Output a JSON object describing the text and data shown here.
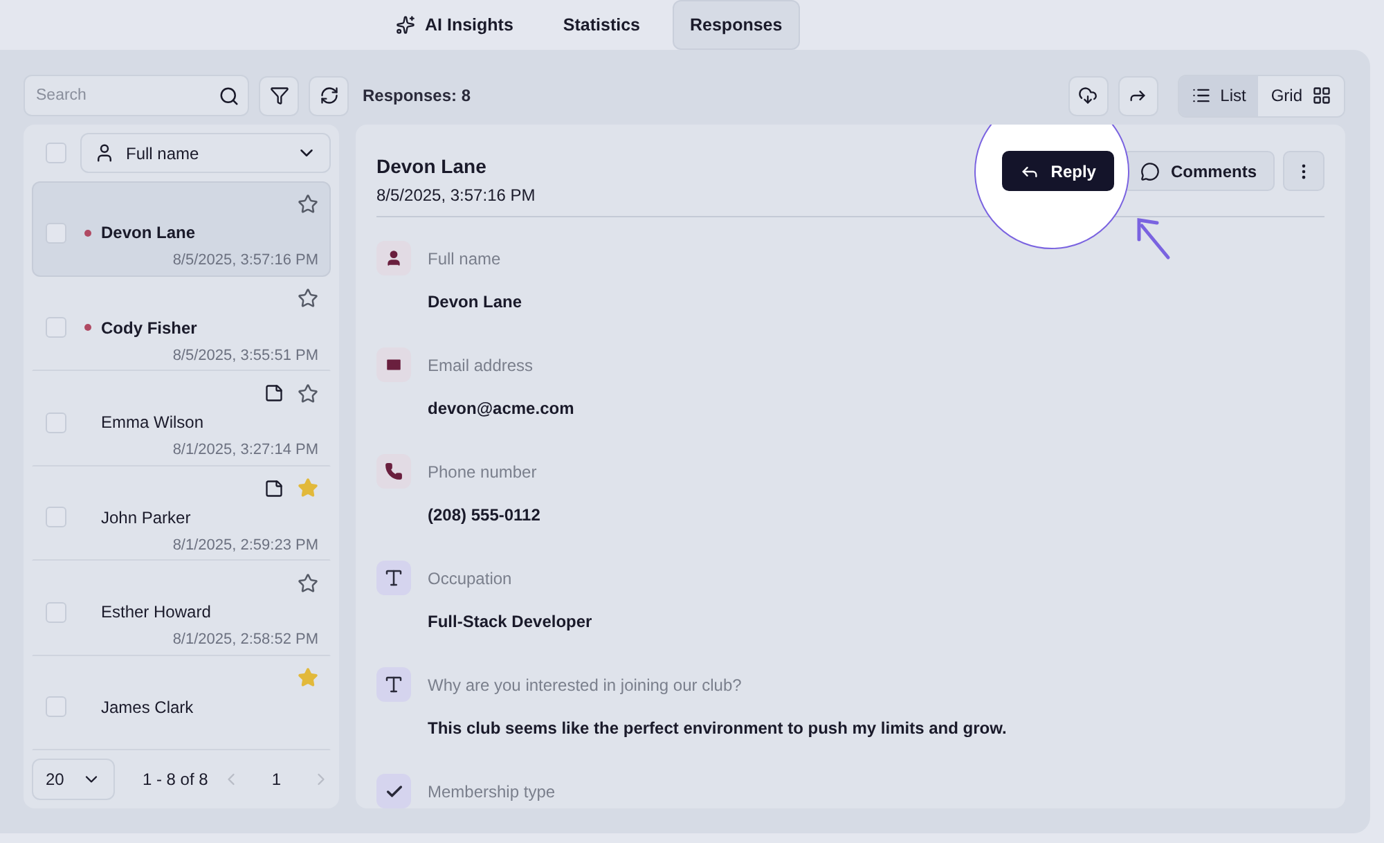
{
  "tabs": [
    {
      "label": "AI Insights",
      "kind": "ai",
      "selected": false
    },
    {
      "label": "Statistics",
      "kind": "plain",
      "selected": false
    },
    {
      "label": "Responses",
      "kind": "plain",
      "selected": true
    }
  ],
  "toolbar": {
    "search": {
      "placeholder": "Search"
    },
    "count": "Responses: 8",
    "views": [
      {
        "label": "List",
        "kind": "list",
        "selected": true
      },
      {
        "label": "Grid",
        "kind": "grid",
        "selected": false
      }
    ]
  },
  "list": {
    "select_all_checked": false,
    "sort_field": "Full name",
    "items": [
      {
        "name": "Devon Lane",
        "date": "8/5/2025, 3:57:16 PM",
        "selected": true,
        "unread": true,
        "starred": false,
        "has_note": false,
        "checked": false
      },
      {
        "name": "Cody Fisher",
        "date": "8/5/2025, 3:55:51 PM",
        "selected": false,
        "unread": true,
        "starred": false,
        "has_note": false,
        "checked": false
      },
      {
        "name": "Emma Wilson",
        "date": "8/1/2025, 3:27:14 PM",
        "selected": false,
        "unread": false,
        "starred": false,
        "has_note": true,
        "checked": false
      },
      {
        "name": "John Parker",
        "date": "8/1/2025, 2:59:23 PM",
        "selected": false,
        "unread": false,
        "starred": true,
        "has_note": true,
        "checked": false
      },
      {
        "name": "Esther Howard",
        "date": "8/1/2025, 2:58:52 PM",
        "selected": false,
        "unread": false,
        "starred": false,
        "has_note": false,
        "checked": false
      },
      {
        "name": "James Clark",
        "selected": false,
        "unread": false,
        "starred": true,
        "has_note": false,
        "checked": false
      }
    ],
    "pagination": {
      "page_size": "20",
      "range": "1 - 8 of 8",
      "page": "1"
    }
  },
  "detail": {
    "name": "Devon Lane",
    "date": "8/5/2025, 3:57:16 PM",
    "actions": [
      {
        "label": "Reply",
        "kind": "reply"
      },
      {
        "label": "Comments",
        "kind": "comments"
      }
    ],
    "fields": [
      {
        "kind": "person",
        "label": "Full name",
        "value": "Devon Lane"
      },
      {
        "kind": "email",
        "label": "Email address",
        "value": "devon@acme.com"
      },
      {
        "kind": "phone",
        "label": "Phone number",
        "value": "(208) 555-0112"
      },
      {
        "kind": "text",
        "label": "Occupation",
        "value": "Full-Stack Developer"
      },
      {
        "kind": "text",
        "label": "Why are you interested in joining our club?",
        "value": "This club seems like the perfect environment to push my limits and grow."
      },
      {
        "kind": "check",
        "label": "Membership type"
      }
    ]
  }
}
